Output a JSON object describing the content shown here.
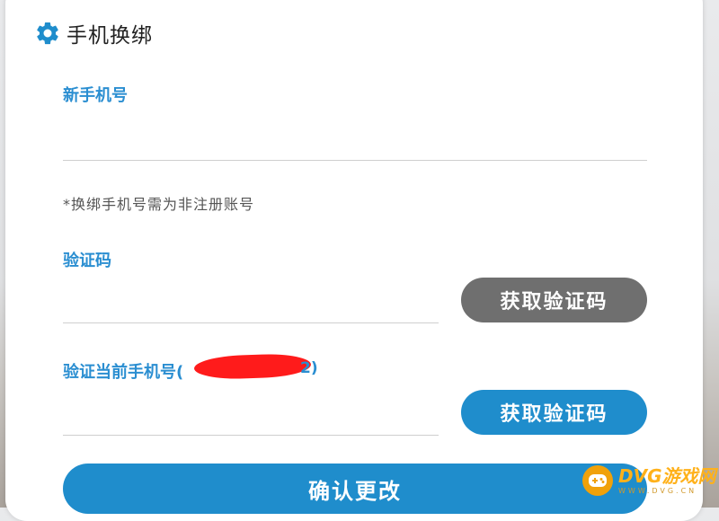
{
  "header": {
    "title": "手机换绑",
    "icon": "gear-icon"
  },
  "new_phone": {
    "label": "新手机号",
    "value": "",
    "placeholder": ""
  },
  "hint": "*换绑手机号需为非注册账号",
  "verify_code": {
    "label": "验证码",
    "value": "",
    "button": "获取验证码"
  },
  "current_phone": {
    "label": "验证当前手机号(",
    "suffix": "2)",
    "value": "",
    "button": "获取验证码"
  },
  "confirm_button": "确认更改",
  "watermark": {
    "main": "DVG游戏网",
    "sub": "WWW.DVG.CN"
  },
  "colors": {
    "accent": "#2a8ed1",
    "button_blue": "#1f8dcc",
    "button_gray": "#6f6f6f",
    "redaction": "#ff1b1b"
  }
}
